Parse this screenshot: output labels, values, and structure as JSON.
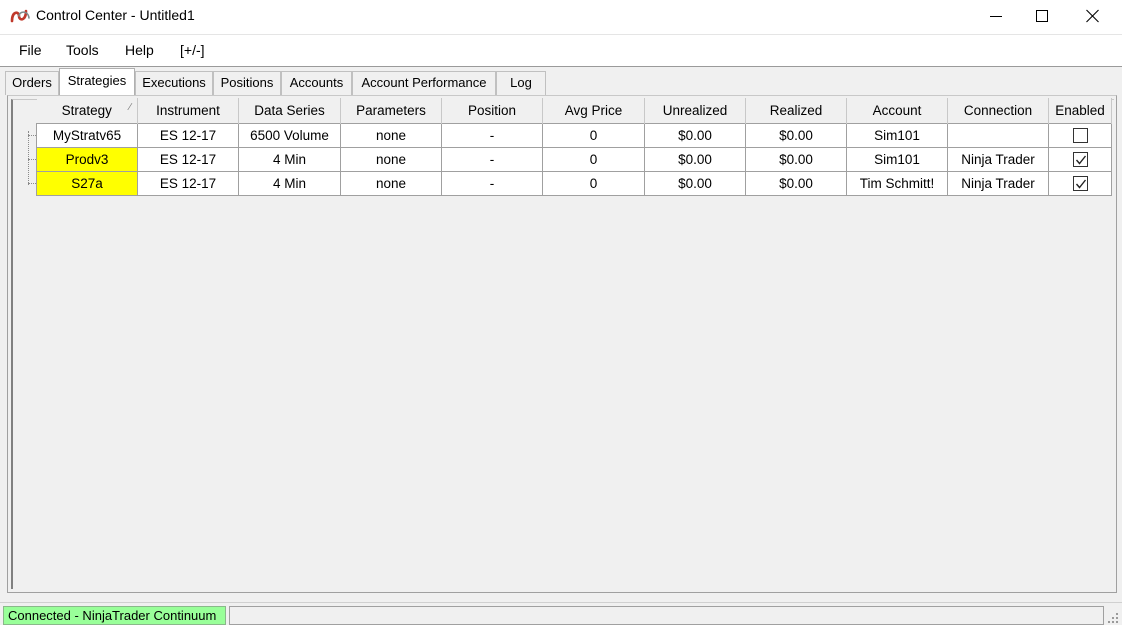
{
  "window": {
    "title": "Control Center - Untitled1",
    "icon": "ninjatrader-logo-icon",
    "controls": [
      "minimize-icon",
      "maximize-icon",
      "close-icon"
    ]
  },
  "menu": {
    "file": "File",
    "tools": "Tools",
    "help": "Help",
    "toggle": "[+/-]"
  },
  "tabs": [
    {
      "label": "Orders"
    },
    {
      "label": "Strategies",
      "active": true
    },
    {
      "label": "Executions"
    },
    {
      "label": "Positions"
    },
    {
      "label": "Accounts"
    },
    {
      "label": "Account Performance"
    },
    {
      "label": "Log"
    }
  ],
  "grid": {
    "columns": [
      "Strategy",
      "Instrument",
      "Data Series",
      "Parameters",
      "Position",
      "Avg Price",
      "Unrealized",
      "Realized",
      "Account",
      "Connection",
      "Enabled"
    ],
    "rows": [
      {
        "strategy": "MyStratv65",
        "instrument": "ES 12-17",
        "data_series": "6500 Volume",
        "parameters": "none",
        "position": "-",
        "avg_price": "0",
        "unrealized": "$0.00",
        "realized": "$0.00",
        "account": "Sim101",
        "connection": "",
        "enabled": false,
        "highlight": false
      },
      {
        "strategy": "Prodv3",
        "instrument": "ES 12-17",
        "data_series": "4 Min",
        "parameters": "none",
        "position": "-",
        "avg_price": "0",
        "unrealized": "$0.00",
        "realized": "$0.00",
        "account": "Sim101",
        "connection": "Ninja Trader",
        "enabled": true,
        "highlight": true
      },
      {
        "strategy": "S27a",
        "instrument": "ES 12-17",
        "data_series": "4 Min",
        "parameters": "none",
        "position": "-",
        "avg_price": "0",
        "unrealized": "$0.00",
        "realized": "$0.00",
        "account": "Tim Schmitt!",
        "connection": "Ninja Trader",
        "enabled": true,
        "highlight": true
      }
    ],
    "highlight_color": "#ffff00"
  },
  "status": {
    "connection": "Connected - NinjaTrader Continuum",
    "connection_color": "#99ff99"
  }
}
